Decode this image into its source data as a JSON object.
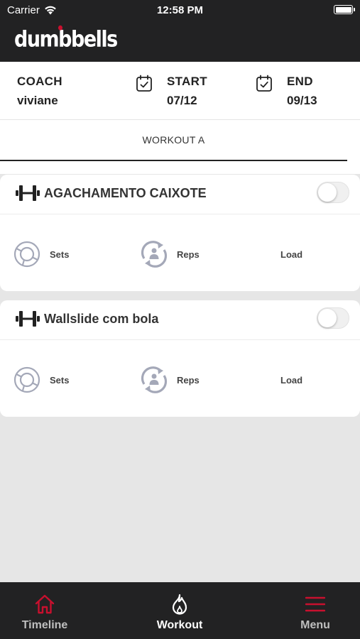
{
  "status_bar": {
    "carrier": "Carrier",
    "time": "12:58 PM"
  },
  "app": {
    "logo_text": "dumbbells"
  },
  "info": {
    "coach_label": "COACH",
    "coach_name": "viviane",
    "start_label": "START",
    "start_date": "07/12",
    "end_label": "END",
    "end_date": "09/13"
  },
  "tabs": [
    {
      "label": "WORKOUT A",
      "selected": true
    }
  ],
  "exercises": [
    {
      "name": "AGACHAMENTO CAIXOTE",
      "enabled": false,
      "sets_label": "Sets",
      "reps_label": "Reps",
      "load_label": "Load"
    },
    {
      "name": "Wallslide com bola",
      "enabled": false,
      "sets_label": "Sets",
      "reps_label": "Reps",
      "load_label": "Load"
    }
  ],
  "bottom_nav": [
    {
      "label": "Timeline",
      "icon": "home-icon",
      "active": false
    },
    {
      "label": "Workout",
      "icon": "flame-icon",
      "active": true
    },
    {
      "label": "Menu",
      "icon": "hamburger-menu-icon",
      "active": false
    }
  ],
  "colors": {
    "brand_red": "#c8102e",
    "header_dark": "#222223",
    "background": "#e6e6e6",
    "nav_inactive": "#bfbfbf"
  }
}
